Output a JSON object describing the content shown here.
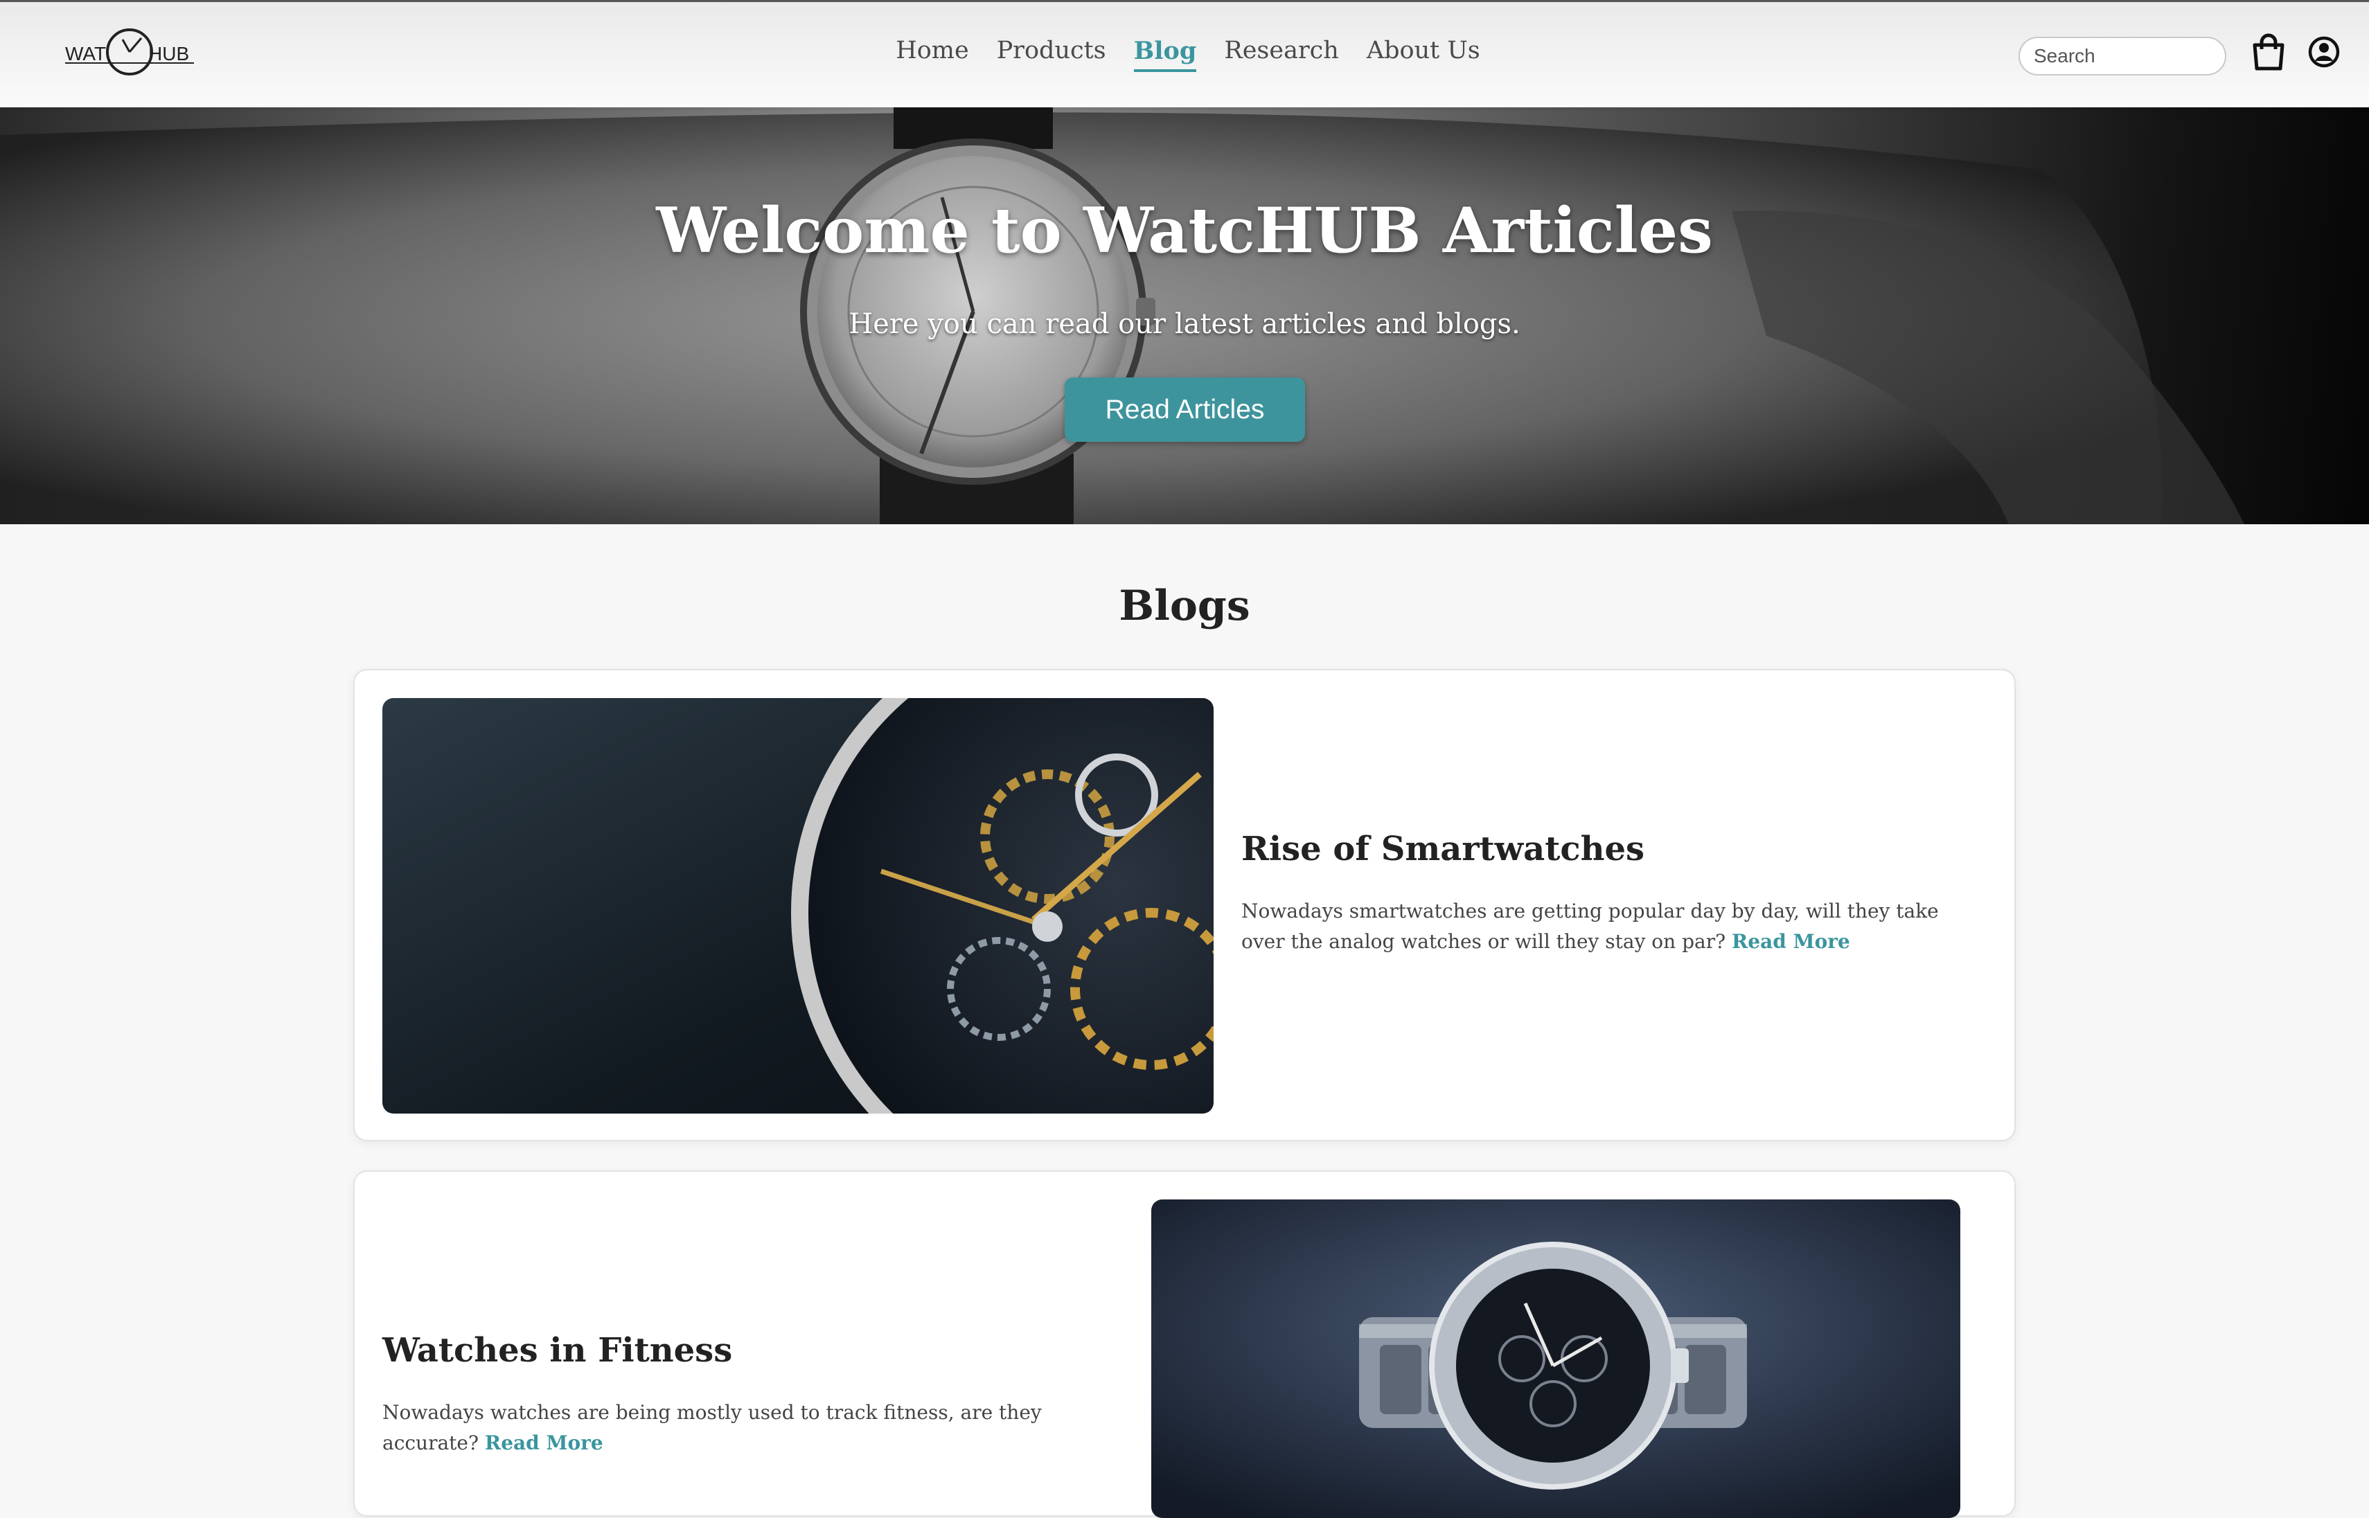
{
  "header": {
    "logo_left": "WAT",
    "logo_right": "HUB",
    "nav": [
      "Home",
      "Products",
      "Blog",
      "Research",
      "About Us"
    ],
    "active_nav": "Blog",
    "search_placeholder": "Search",
    "cart_icon": "shopping-bag-icon",
    "account_icon": "user-circle-icon"
  },
  "hero": {
    "title": "Welcome to WatcHUB Articles",
    "subtitle": "Here you can read our latest articles and blogs.",
    "button_label": "Read Articles"
  },
  "blogs": {
    "heading": "Blogs",
    "items": [
      {
        "title": "Rise of Smartwatches",
        "description": "Nowadays smartwatches are getting popular day by day, will they take over the analog watches or will they stay on par?",
        "read_more": "Read More",
        "image": "skeleton-watch-movement-photo"
      },
      {
        "title": "Watches in Fitness",
        "description": "Nowadays watches are being mostly used to track fitness, are they accurate?",
        "read_more": "Read More",
        "image": "steel-chronograph-watch-photo"
      }
    ]
  },
  "colors": {
    "accent": "#3a959e",
    "button": "#3e949c",
    "page_bg": "#f7f7f7"
  }
}
